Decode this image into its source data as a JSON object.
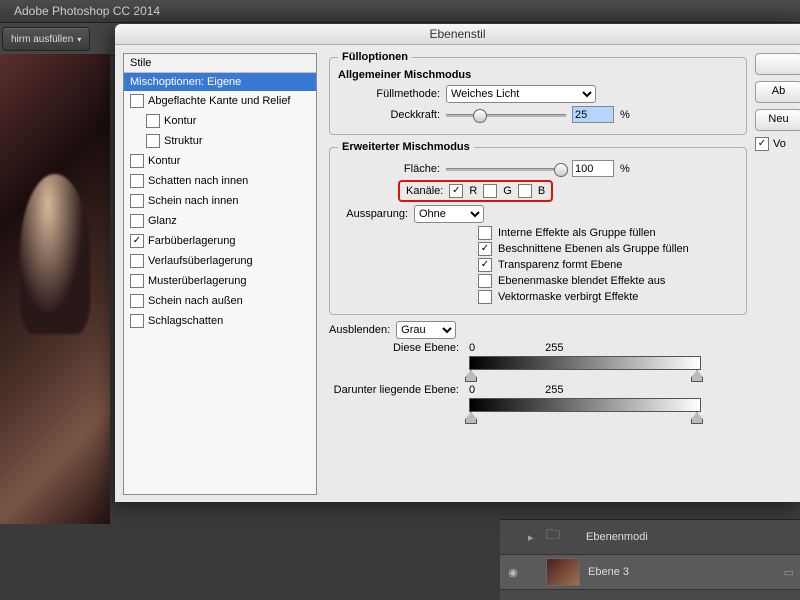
{
  "app": {
    "title": "Adobe Photoshop CC 2014"
  },
  "toolbar": {
    "fill_screen": "hirm ausfüllen"
  },
  "dialog": {
    "title": "Ebenenstil",
    "styles_header": "Stile",
    "styles": [
      {
        "label": "Mischoptionen: Eigene",
        "selected": true,
        "checkbox": false
      },
      {
        "label": "Abgeflachte Kante und Relief",
        "checked": false,
        "checkbox": true
      },
      {
        "label": "Kontur",
        "checked": false,
        "checkbox": true,
        "indent": 1
      },
      {
        "label": "Struktur",
        "checked": false,
        "checkbox": true,
        "indent": 1
      },
      {
        "label": "Kontur",
        "checked": false,
        "checkbox": true
      },
      {
        "label": "Schatten nach innen",
        "checked": false,
        "checkbox": true
      },
      {
        "label": "Schein nach innen",
        "checked": false,
        "checkbox": true
      },
      {
        "label": "Glanz",
        "checked": false,
        "checkbox": true
      },
      {
        "label": "Farbüberlagerung",
        "checked": true,
        "checkbox": true
      },
      {
        "label": "Verlaufsüberlagerung",
        "checked": false,
        "checkbox": true
      },
      {
        "label": "Musterüberlagerung",
        "checked": false,
        "checkbox": true
      },
      {
        "label": "Schein nach außen",
        "checked": false,
        "checkbox": true
      },
      {
        "label": "Schlagschatten",
        "checked": false,
        "checkbox": true
      }
    ],
    "fill_options": {
      "legend": "Fülloptionen",
      "general_title": "Allgemeiner Mischmodus",
      "blend_mode_label": "Füllmethode:",
      "blend_mode_value": "Weiches Licht",
      "opacity_label": "Deckkraft:",
      "opacity_value": "25",
      "opacity_pct": 25,
      "pct": "%"
    },
    "advanced": {
      "legend": "Erweiterter Mischmodus",
      "fill_label": "Fläche:",
      "fill_value": "100",
      "fill_pct": 100,
      "pct": "%",
      "channels_label": "Kanäle:",
      "channels": {
        "R": true,
        "G": false,
        "B": false
      },
      "knockout_label": "Aussparung:",
      "knockout_value": "Ohne",
      "fx": [
        {
          "label": "Interne Effekte als Gruppe füllen",
          "checked": false
        },
        {
          "label": "Beschnittene Ebenen als Gruppe füllen",
          "checked": true
        },
        {
          "label": "Transparenz formt Ebene",
          "checked": true
        },
        {
          "label": "Ebenenmaske blendet Effekte aus",
          "checked": false
        },
        {
          "label": "Vektormaske verbirgt Effekte",
          "checked": false
        }
      ]
    },
    "blendif": {
      "label": "Ausblenden:",
      "value": "Grau",
      "this_layer_label": "Diese Ebene:",
      "this_low": "0",
      "this_high": "255",
      "under_layer_label": "Darunter liegende Ebene:",
      "under_low": "0",
      "under_high": "255"
    },
    "buttons": {
      "ok": " ",
      "cancel": "Ab",
      "new_style": "Neu",
      "preview": "Vo"
    }
  },
  "layers": {
    "group": "Ebenenmodi",
    "layer": "Ebene 3"
  }
}
